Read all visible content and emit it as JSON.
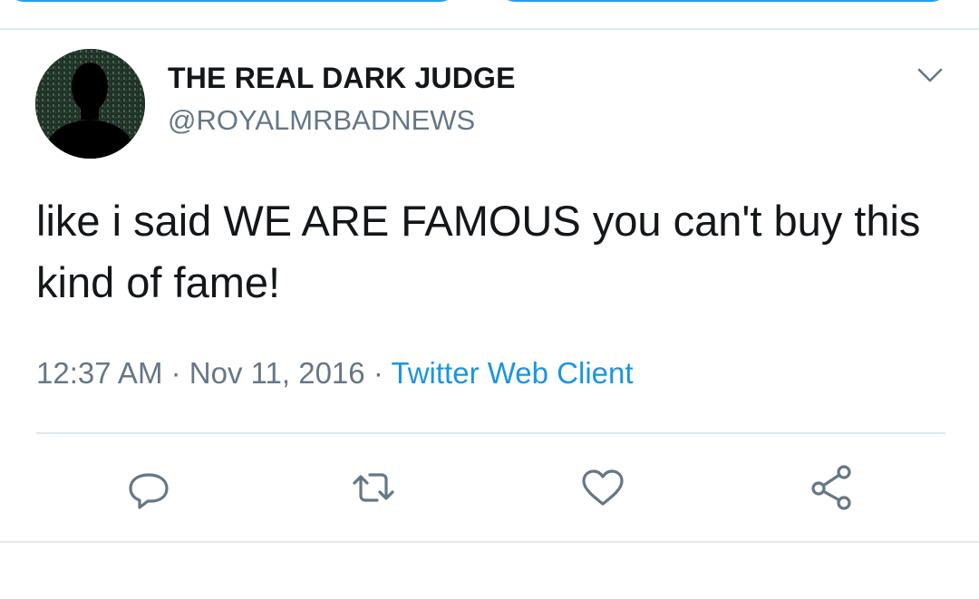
{
  "tweet": {
    "display_name": "THE REAL DARK JUDGE",
    "handle": "@ROYALMRBADNEWS",
    "text": "like i said WE ARE FAMOUS you can't buy this kind of fame!",
    "time": "12:37 AM",
    "separator": "·",
    "date": "Nov 11, 2016",
    "client": "Twitter Web Client"
  },
  "icons": {
    "avatar": "silhouette-avatar",
    "menu": "chevron-down-icon",
    "reply": "reply-icon",
    "retweet": "retweet-icon",
    "like": "heart-icon",
    "share": "share-icon"
  },
  "colors": {
    "text": "#14171a",
    "secondary": "#657786",
    "link": "#1b95e0",
    "accent": "#1da1f2",
    "divider": "#e1e8ed"
  }
}
